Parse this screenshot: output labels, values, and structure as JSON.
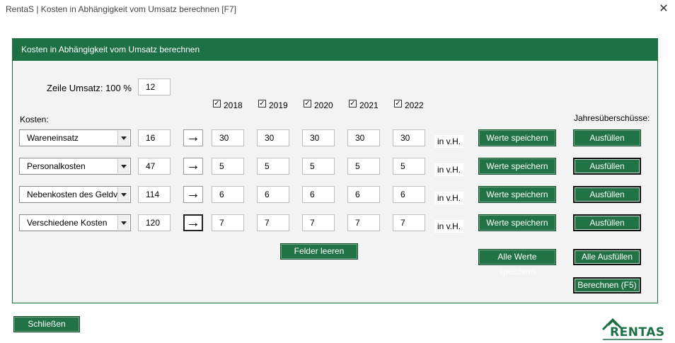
{
  "window": {
    "title": "RentaS | Kosten in Abhängigkeit vom Umsatz berechnen [F7]"
  },
  "panel": {
    "header": "Kosten in Abhängigkeit vom Umsatz berechnen"
  },
  "revenue_row": {
    "label": "Zeile Umsatz: 100 %",
    "value": "12"
  },
  "years": [
    {
      "label": "2018",
      "checked": true
    },
    {
      "label": "2019",
      "checked": true
    },
    {
      "label": "2020",
      "checked": true
    },
    {
      "label": "2021",
      "checked": true
    },
    {
      "label": "2022",
      "checked": true
    }
  ],
  "kosten_label": "Kosten:",
  "jahres_label": "Jahresüberschüsse:",
  "rows": [
    {
      "category": "Wareneinsatz",
      "line": "16",
      "values": [
        "30",
        "30",
        "30",
        "30",
        "30"
      ],
      "unit": "in v.H.",
      "save_label": "Werte speichern",
      "fill_label": "Ausfüllen"
    },
    {
      "category": "Personalkosten",
      "line": "47",
      "values": [
        "5",
        "5",
        "5",
        "5",
        "5"
      ],
      "unit": "in v.H.",
      "save_label": "Werte speichern",
      "fill_label": "Ausfüllen"
    },
    {
      "category": "Nebenkosten des Geldverkehrs",
      "line": "114",
      "values": [
        "6",
        "6",
        "6",
        "6",
        "6"
      ],
      "unit": "in v.H.",
      "save_label": "Werte speichern",
      "fill_label": "Ausfüllen"
    },
    {
      "category": "Verschiedene Kosten",
      "line": "120",
      "values": [
        "7",
        "7",
        "7",
        "7",
        "7"
      ],
      "unit": "in v.H.",
      "save_label": "Werte speichern",
      "fill_label": "Ausfüllen"
    }
  ],
  "buttons": {
    "clear_fields": "Felder leeren",
    "save_all": "Alle Werte speichern",
    "fill_all": "Alle Ausfüllen",
    "calculate": "Berechnen (F5)",
    "close": "Schließen"
  },
  "logo": {
    "text": "RENTAS"
  },
  "colors": {
    "accent": "#1e7145",
    "button": "#217346",
    "panel_bg": "#f3f3f3"
  }
}
